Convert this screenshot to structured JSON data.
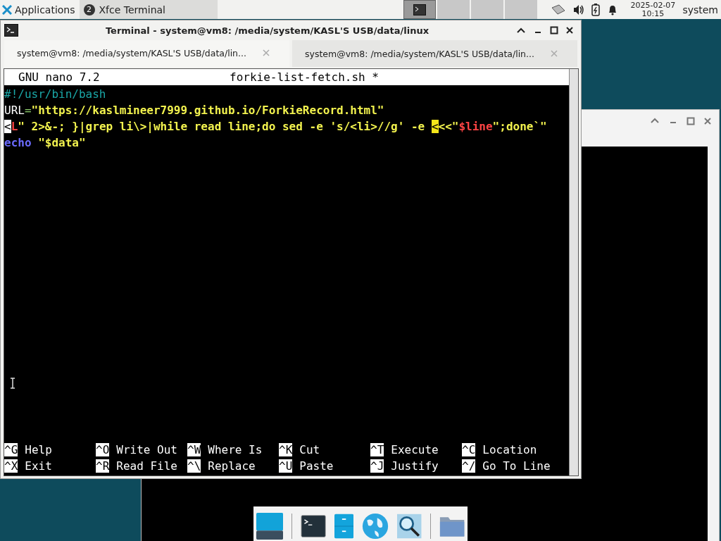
{
  "panel": {
    "applications": "Applications",
    "tasks": [
      {
        "label": "Xfce Terminal",
        "count": "2",
        "selected": true
      }
    ],
    "workspaces": [
      {
        "selected": true
      },
      {
        "selected": false
      },
      {
        "selected": false
      },
      {
        "selected": false
      }
    ],
    "date": "2025-02-07",
    "time": "10:15",
    "user": "system"
  },
  "window": {
    "title": "Terminal - system@vm8: /media/system/KASL'S USB/data/linux",
    "tabs": [
      {
        "label": "system@vm8: /media/system/KASL'S USB/data/lin...",
        "selected": true
      },
      {
        "label": "system@vm8: /media/system/KASL'S USB/data/lin...",
        "selected": false
      }
    ],
    "nano": {
      "version": "GNU nano 7.2",
      "filename": "forkie-list-fetch.sh *",
      "lines": [
        [
          {
            "kind": "comment",
            "text": "#!/usr/bin/bash"
          }
        ],
        [
          {
            "kind": "plain",
            "text": "URL"
          },
          {
            "kind": "operator",
            "text": "="
          },
          {
            "kind": "string",
            "text": "\"https://kaslmineer7999.github.io/ForkieRecord.html\""
          }
        ],
        [
          {
            "kind": "marker",
            "text": "<"
          },
          {
            "kind": "variable",
            "text": "L"
          },
          {
            "kind": "string",
            "text": "\" 2>&-; }|grep li\\>|while read line;do sed -e 's/<li>//g' -e "
          },
          {
            "kind": "cursor",
            "text": "<"
          },
          {
            "kind": "string",
            "text": "<<\""
          },
          {
            "kind": "variable",
            "text": "$line"
          },
          {
            "kind": "string",
            "text": "\";done`\""
          }
        ],
        [
          {
            "kind": "keyword",
            "text": "echo"
          },
          {
            "kind": "string",
            "text": " \"$data\""
          }
        ]
      ],
      "shortcuts": [
        [
          {
            "key": "^G",
            "label": "Help"
          },
          {
            "key": "^O",
            "label": "Write Out"
          },
          {
            "key": "^W",
            "label": "Where Is"
          },
          {
            "key": "^K",
            "label": "Cut"
          },
          {
            "key": "^T",
            "label": "Execute"
          },
          {
            "key": "^C",
            "label": "Location"
          }
        ],
        [
          {
            "key": "^X",
            "label": "Exit"
          },
          {
            "key": "^R",
            "label": "Read File"
          },
          {
            "key": "^\\",
            "label": "Replace"
          },
          {
            "key": "^U",
            "label": "Paste"
          },
          {
            "key": "^J",
            "label": "Justify"
          },
          {
            "key": "^/",
            "label": "Go To Line"
          }
        ]
      ]
    }
  },
  "dock": [
    {
      "kind": "desktop"
    },
    {
      "kind": "terminal"
    },
    {
      "kind": "files"
    },
    {
      "kind": "browser"
    },
    {
      "kind": "search"
    },
    {
      "kind": "folder"
    }
  ]
}
